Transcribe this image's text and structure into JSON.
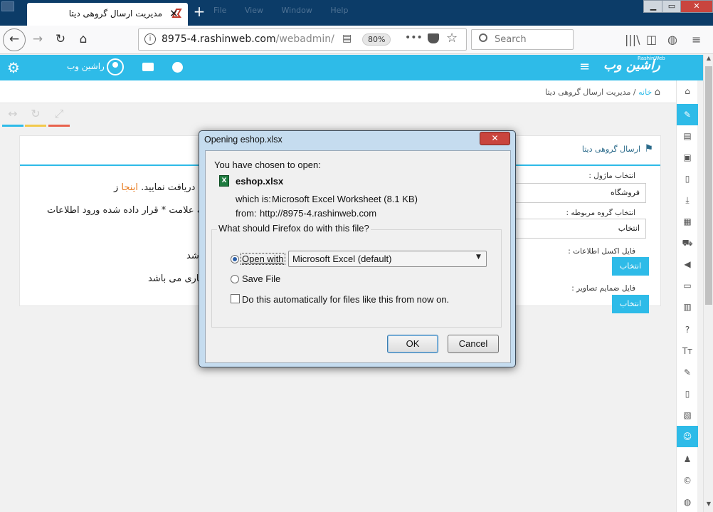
{
  "browser": {
    "tab_title": "مدیریت ارسال گروهی دیتا",
    "tab_close": "✕",
    "new_tab": "+",
    "menu_hints": "File View Window Help",
    "window_controls": {
      "minimize": "▁",
      "restore": "▭",
      "close": "✕"
    },
    "url_host": "8975-4.rashinweb.com",
    "url_path": "/webadmin/",
    "zoom": "80%",
    "more": "•••",
    "search_placeholder": "Search",
    "icons": [
      "back-arrow",
      "forward-arrow",
      "reload",
      "home",
      "site-info",
      "reader-view",
      "pocket",
      "bookmark-star",
      "library",
      "sidebar",
      "globe"
    ]
  },
  "app": {
    "brand_logo": "راشین وب",
    "brand_sub": "RashinWeb",
    "user_name": "راشین وب",
    "header_icons": [
      "gear-icon",
      "user-avatar-icon",
      "card-icon",
      "globe-icon",
      "hamburger-icon"
    ],
    "accent_color": "#2ebbe8"
  },
  "breadcrumb": {
    "home": "خانه",
    "separator": "/",
    "current": "مدیریت ارسال گروهی دیتا"
  },
  "panel": {
    "title": "ارسال گروهی دیتا",
    "form": {
      "module_label": "انتخاب ماژول :",
      "module_value": "فروشگاه",
      "group_label": "انتخاب گروه مربوطه :",
      "group_value": "انتخاب",
      "excel_label": "فایل اکسل اطلاعات :",
      "excel_button": "انتخاب",
      "images_label": "فایل ضمایم تصاویر :",
      "images_button": "انتخاب"
    },
    "left_text": {
      "line1_cut": "ز",
      "line1_link": "اینجا",
      "line1_rest": "دریافت نمایید.",
      "line2": "که علامت * قرار داده شده ورود اطلاعات",
      "line3": "شد",
      "line4": "باری می باشد"
    }
  },
  "dialog": {
    "title": "Opening eshop.xlsx",
    "close": "✕",
    "chosen_text": "You have chosen to open:",
    "file_name": "eshop.xlsx",
    "file_icon": "X",
    "which_is_label": "which is:",
    "which_is_value": "Microsoft Excel Worksheet (8.1 KB)",
    "from_label": "from:",
    "from_value": "http://8975-4.rashinweb.com",
    "question": "What should Firefox do with this file?",
    "open_with_label": "Open with",
    "open_with_app": "Microsoft Excel (default)",
    "save_file_label": "Save File",
    "auto_label": "Do this automatically for files like this from now on.",
    "selected_option": "open_with",
    "auto_checked": false,
    "ok": "OK",
    "cancel": "Cancel"
  },
  "sidebar": {
    "items": [
      {
        "icon": "home-icon",
        "glyph": "⌂",
        "active": false
      },
      {
        "icon": "pencil-icon",
        "glyph": "✎",
        "active": true
      },
      {
        "icon": "id-card-icon",
        "glyph": "▤",
        "active": false
      },
      {
        "icon": "image-icon",
        "glyph": "▣",
        "active": false
      },
      {
        "icon": "file-icon",
        "glyph": "▯",
        "active": false
      },
      {
        "icon": "download-icon",
        "glyph": "⤓",
        "active": false
      },
      {
        "icon": "film-icon",
        "glyph": "▦",
        "active": false
      },
      {
        "icon": "cart-icon",
        "glyph": "⛟",
        "active": false
      },
      {
        "icon": "volume-icon",
        "glyph": "◀",
        "active": false
      },
      {
        "icon": "monitor-icon",
        "glyph": "▭",
        "active": false
      },
      {
        "icon": "book-icon",
        "glyph": "▥",
        "active": false
      },
      {
        "icon": "question-icon",
        "glyph": "?",
        "active": false
      },
      {
        "icon": "text-icon",
        "glyph": "Tт",
        "active": false
      },
      {
        "icon": "pin-icon",
        "glyph": "✎",
        "active": false
      },
      {
        "icon": "page-icon",
        "glyph": "▯",
        "active": false
      },
      {
        "icon": "pdf-icon",
        "glyph": "▧",
        "active": false
      },
      {
        "icon": "group-icon",
        "glyph": "☺",
        "active": true
      },
      {
        "icon": "user-icon",
        "glyph": "♟",
        "active": false
      },
      {
        "icon": "copyright-icon",
        "glyph": "©",
        "active": false
      },
      {
        "icon": "globe-icon",
        "glyph": "◍",
        "active": false
      }
    ]
  },
  "tools": [
    {
      "icon": "expand-arrows-icon",
      "glyph": "↔",
      "underline": "#2ebbe8"
    },
    {
      "icon": "refresh-icon",
      "glyph": "↻",
      "underline": "#f2c94c"
    },
    {
      "icon": "fullscreen-icon",
      "glyph": "⤢",
      "underline": "#e8634e"
    }
  ]
}
